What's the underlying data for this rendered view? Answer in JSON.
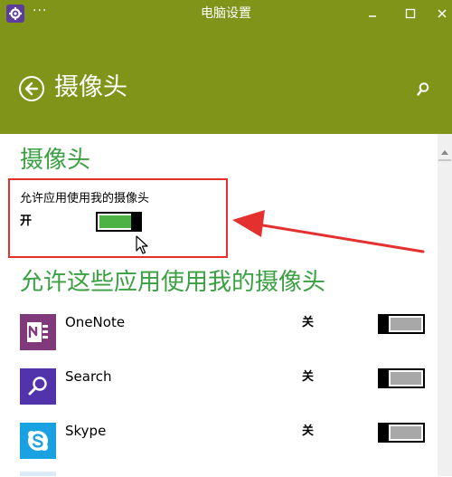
{
  "window": {
    "title": "电脑设置",
    "menu_glyph": "···"
  },
  "header": {
    "title": "摄像头"
  },
  "camera_section": {
    "title": "摄像头",
    "allow_label": "允许应用使用我的摄像头",
    "state_label": "开",
    "toggle_on": true
  },
  "apps_section": {
    "title": "允许这些应用使用我的摄像头",
    "apps": [
      {
        "name": "OneNote",
        "state": "关",
        "enabled": false,
        "icon": "onenote-icon",
        "color": "#80397b"
      },
      {
        "name": "Search",
        "state": "关",
        "enabled": false,
        "icon": "search-icon",
        "color": "#5133ab"
      },
      {
        "name": "Skype",
        "state": "关",
        "enabled": false,
        "icon": "skype-icon",
        "color": "#1aa1e1"
      }
    ]
  },
  "colors": {
    "accent": "#7f9419",
    "section_title": "#3aa041",
    "toggle_on": "#4cb244",
    "highlight_box": "#e53030"
  }
}
